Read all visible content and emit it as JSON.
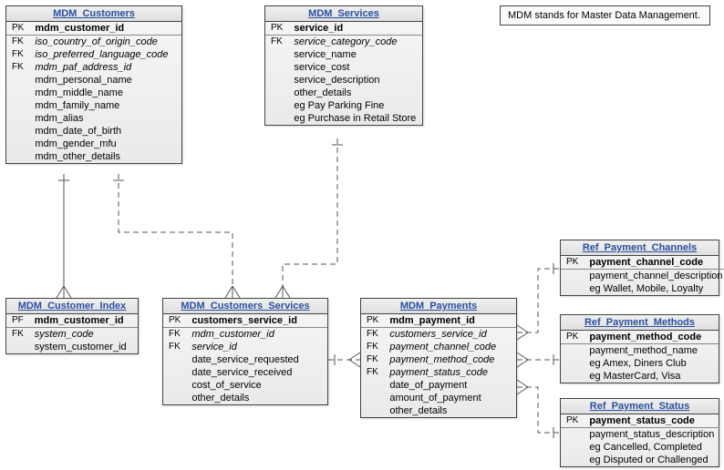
{
  "note": {
    "text": "MDM stands for Master Data Management."
  },
  "entities": {
    "customers": {
      "title": "MDM_Customers",
      "rows": [
        {
          "k": "PK",
          "n": "mdm_customer_id",
          "pk": true
        },
        {
          "k": "FK",
          "n": "iso_country_of_origin_code",
          "fk": true
        },
        {
          "k": "FK",
          "n": "iso_preferred_language_code",
          "fk": true
        },
        {
          "k": "FK",
          "n": "mdm_paf_address_id",
          "fk": true
        },
        {
          "k": "",
          "n": "mdm_personal_name"
        },
        {
          "k": "",
          "n": "mdm_middle_name"
        },
        {
          "k": "",
          "n": "mdm_family_name"
        },
        {
          "k": "",
          "n": "mdm_alias"
        },
        {
          "k": "",
          "n": "mdm_date_of_birth"
        },
        {
          "k": "",
          "n": "mdm_gender_mfu"
        },
        {
          "k": "",
          "n": "mdm_other_details"
        }
      ]
    },
    "services": {
      "title": "MDM_Services",
      "rows": [
        {
          "k": "PK",
          "n": "service_id",
          "pk": true
        },
        {
          "k": "FK",
          "n": "service_category_code",
          "fk": true
        },
        {
          "k": "",
          "n": "service_name"
        },
        {
          "k": "",
          "n": "service_cost"
        },
        {
          "k": "",
          "n": "service_description"
        },
        {
          "k": "",
          "n": "other_details"
        },
        {
          "k": "",
          "n": "eg Pay Parking Fine"
        },
        {
          "k": "",
          "n": "eg Purchase in Retail Store"
        }
      ]
    },
    "cust_index": {
      "title": "MDM_Customer_Index",
      "rows": [
        {
          "k": "PF",
          "n": "mdm_customer_id",
          "pk": true
        },
        {
          "k": "FK",
          "n": "system_code",
          "fk": true
        },
        {
          "k": "",
          "n": "system_customer_id"
        }
      ]
    },
    "cust_services": {
      "title": "MDM_Customers_Services",
      "rows": [
        {
          "k": "PK",
          "n": "customers_service_id",
          "pk": true
        },
        {
          "k": "FK",
          "n": "mdm_customer_id",
          "fk": true
        },
        {
          "k": "FK",
          "n": "service_id",
          "fk": true
        },
        {
          "k": "",
          "n": "date_service_requested"
        },
        {
          "k": "",
          "n": "date_service_received"
        },
        {
          "k": "",
          "n": "cost_of_service"
        },
        {
          "k": "",
          "n": "other_details"
        }
      ]
    },
    "payments": {
      "title": "MDM_Payments",
      "rows": [
        {
          "k": "PK",
          "n": "mdm_payment_id",
          "pk": true
        },
        {
          "k": "FK",
          "n": "customers_service_id",
          "fk": true
        },
        {
          "k": "FK",
          "n": "payment_channel_code",
          "fk": true
        },
        {
          "k": "FK",
          "n": "payment_method_code",
          "fk": true
        },
        {
          "k": "FK",
          "n": "payment_status_code",
          "fk": true
        },
        {
          "k": "",
          "n": "date_of_payment"
        },
        {
          "k": "",
          "n": "amount_of_payment"
        },
        {
          "k": "",
          "n": "other_details"
        }
      ]
    },
    "ref_channels": {
      "title": "Ref_Payment_Channels",
      "rows": [
        {
          "k": "PK",
          "n": "payment_channel_code",
          "pk": true
        },
        {
          "k": "",
          "n": "payment_channel_description"
        },
        {
          "k": "",
          "n": "eg Wallet, Mobile, Loyalty"
        }
      ]
    },
    "ref_methods": {
      "title": "Ref_Payment_Methods",
      "rows": [
        {
          "k": "PK",
          "n": "payment_method_code",
          "pk": true
        },
        {
          "k": "",
          "n": "payment_method_name"
        },
        {
          "k": "",
          "n": "eg Amex, Diners Club"
        },
        {
          "k": "",
          "n": "eg MasterCard, Visa"
        }
      ]
    },
    "ref_status": {
      "title": "Ref_Payment_Status",
      "rows": [
        {
          "k": "PK",
          "n": "payment_status_code",
          "pk": true
        },
        {
          "k": "",
          "n": "payment_status_description"
        },
        {
          "k": "",
          "n": "eg Cancelled, Completed"
        },
        {
          "k": "",
          "n": "eg Disputed or Challenged"
        }
      ]
    }
  }
}
